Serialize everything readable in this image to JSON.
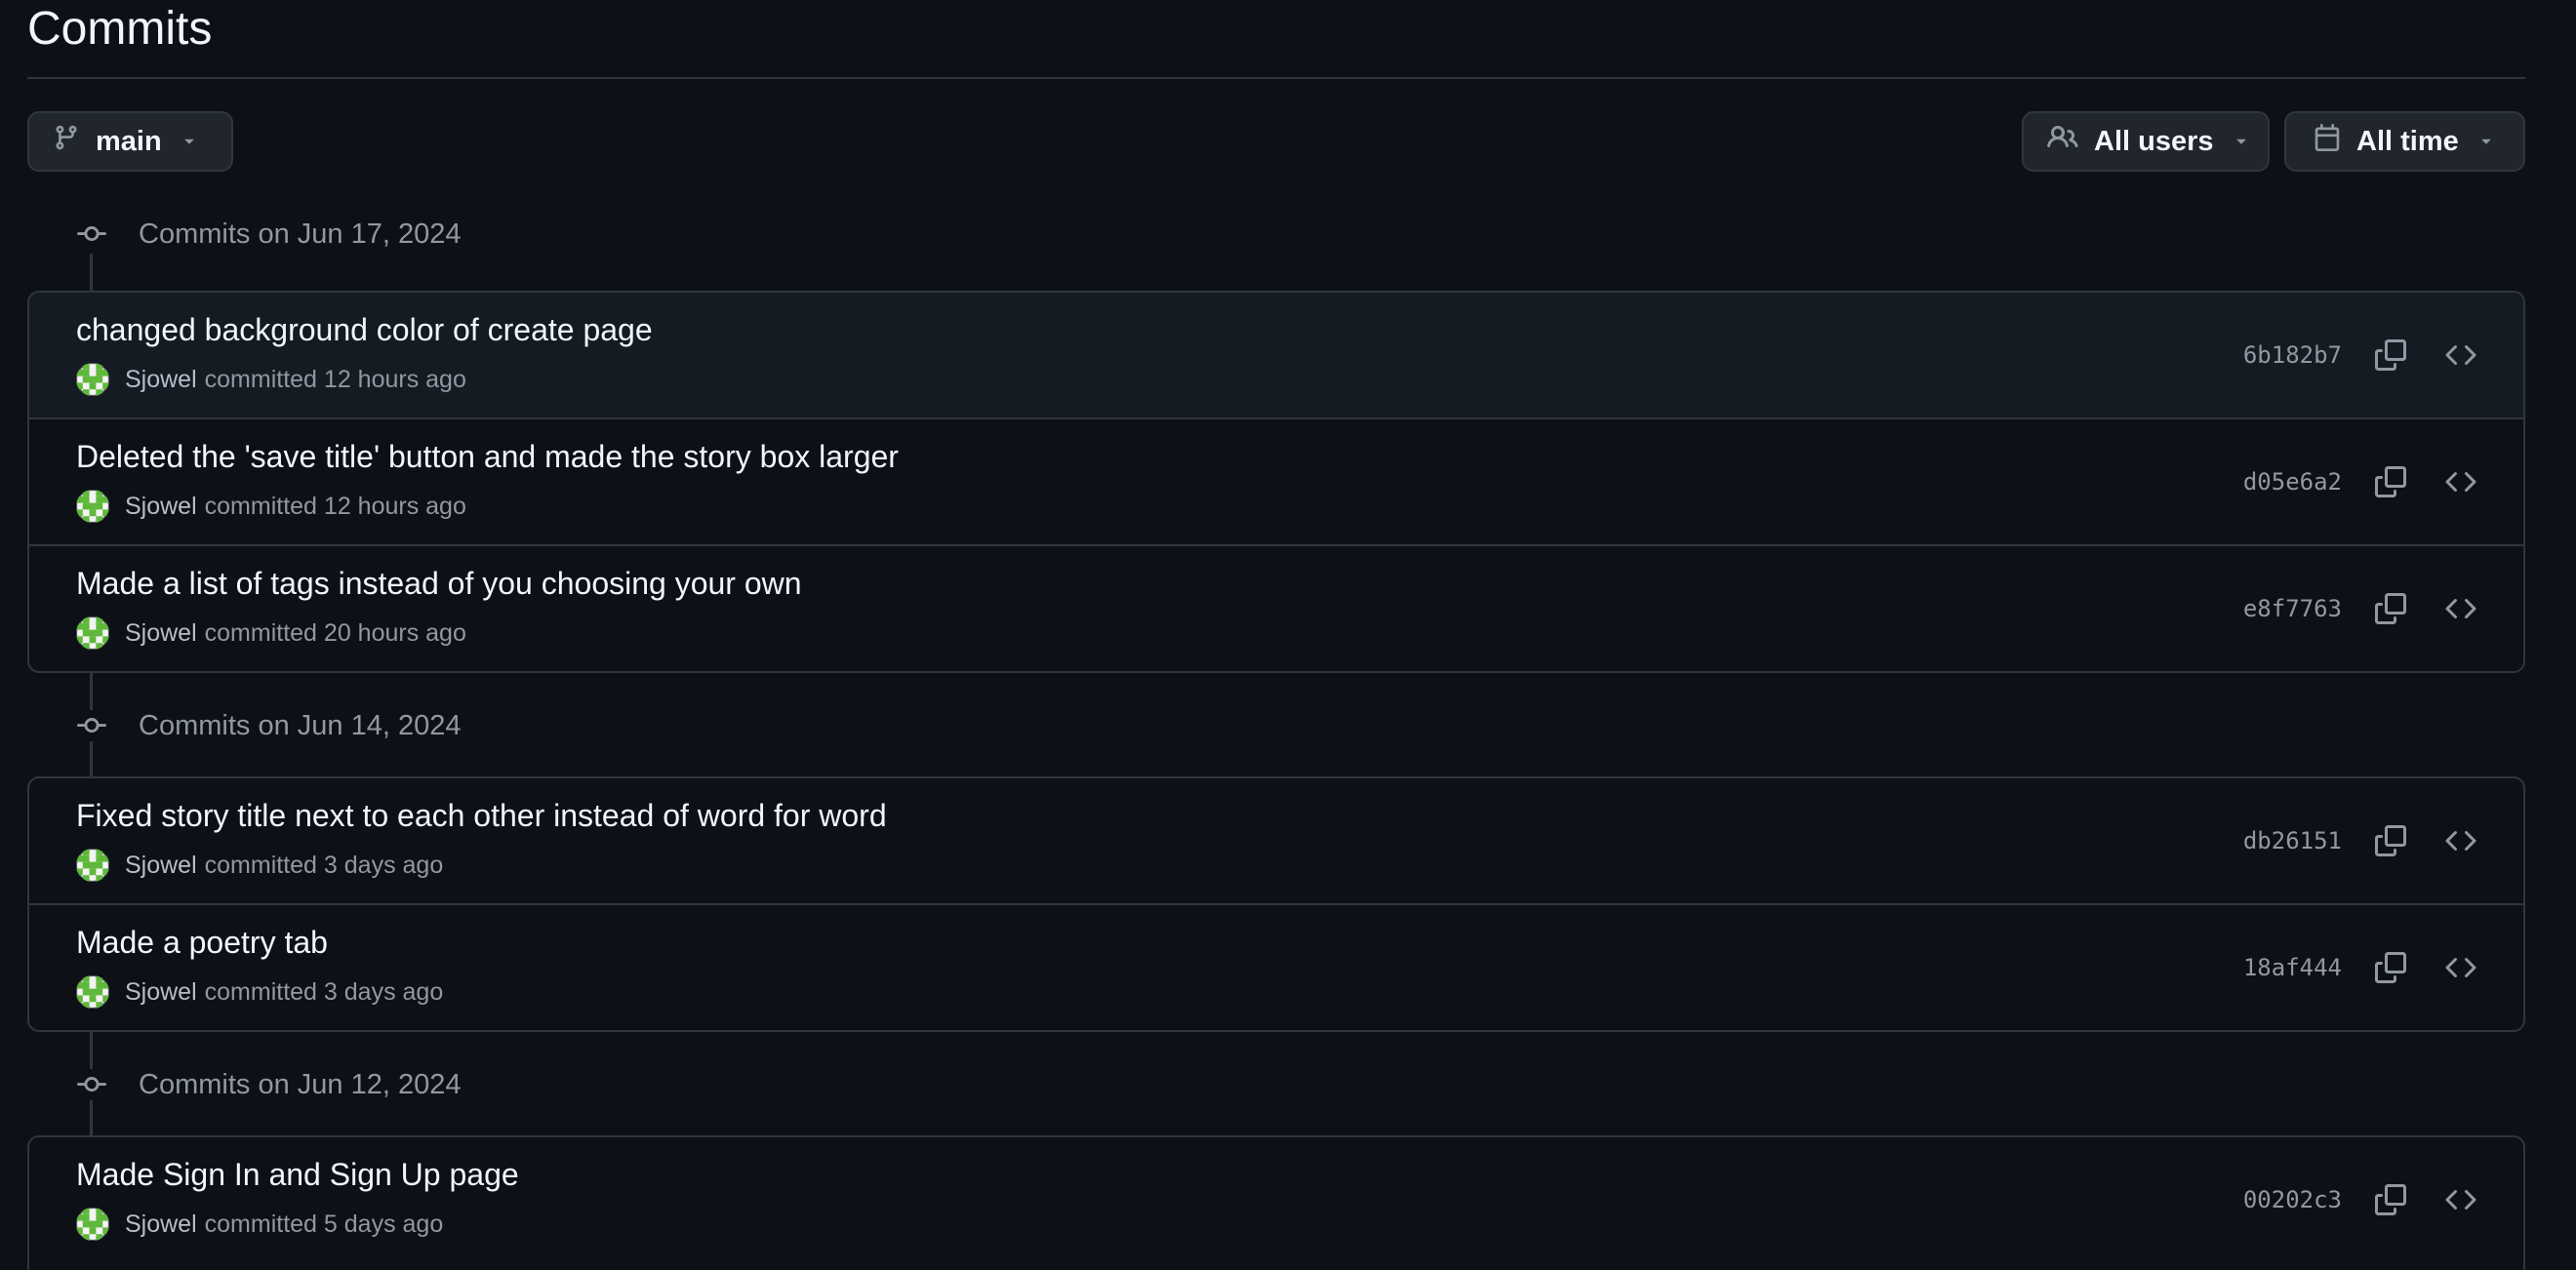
{
  "page": {
    "title": "Commits"
  },
  "toolbar": {
    "branch_label": "main",
    "users_label": "All users",
    "time_label": "All time"
  },
  "icons": {
    "branch": "git-branch-icon",
    "users": "people-icon",
    "calendar": "calendar-icon",
    "caret": "triangle-down-icon",
    "commit_node": "git-commit-icon",
    "copy": "copy-icon",
    "browse": "code-icon"
  },
  "colors": {
    "background": "#0d1117",
    "border": "#30363d",
    "text": "#f0f6fc",
    "muted": "#9198a1",
    "avatar_green": "#5fb83b"
  },
  "groups": [
    {
      "date_label": "Commits on Jun 17, 2024",
      "commits": [
        {
          "message": "changed background color of create page",
          "author": "Sjowel",
          "time": "committed 12 hours ago",
          "sha": "6b182b7"
        },
        {
          "message": "Deleted the 'save title' button and made the story box larger",
          "author": "Sjowel",
          "time": "committed 12 hours ago",
          "sha": "d05e6a2"
        },
        {
          "message": "Made a list of tags instead of you choosing your own",
          "author": "Sjowel",
          "time": "committed 20 hours ago",
          "sha": "e8f7763"
        }
      ]
    },
    {
      "date_label": "Commits on Jun 14, 2024",
      "commits": [
        {
          "message": "Fixed story title next to each other instead of word for word",
          "author": "Sjowel",
          "time": "committed 3 days ago",
          "sha": "db26151"
        },
        {
          "message": "Made a poetry tab",
          "author": "Sjowel",
          "time": "committed 3 days ago",
          "sha": "18af444"
        }
      ]
    },
    {
      "date_label": "Commits on Jun 12, 2024",
      "commits": [
        {
          "message": "Made Sign In and Sign Up page",
          "author": "Sjowel",
          "time": "committed 5 days ago",
          "sha": "00202c3"
        }
      ]
    }
  ]
}
